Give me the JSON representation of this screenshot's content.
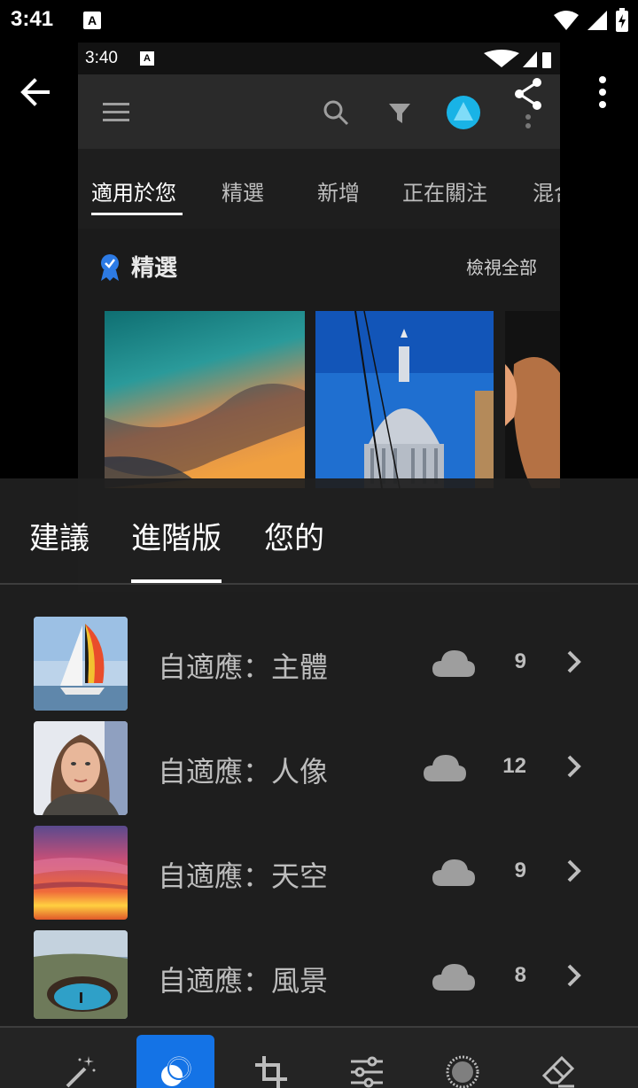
{
  "status_bar": {
    "time": "3:41",
    "notification_icon": "A"
  },
  "embedded": {
    "status_time": "3:40",
    "notification_icon": "A",
    "tabs": [
      "適用於您",
      "精選",
      "新增",
      "正在關注",
      "混合"
    ],
    "featured": {
      "title": "精選",
      "view_all": "檢視全部"
    }
  },
  "sheet": {
    "tabs": [
      "建議",
      "進階版",
      "您的"
    ],
    "active_tab": "進階版",
    "presets": [
      {
        "label": "自適應：主體",
        "count": "9",
        "thumb": "sailboat"
      },
      {
        "label": "自適應：人像",
        "count": "12",
        "thumb": "portrait"
      },
      {
        "label": "自適應：天空",
        "count": "9",
        "thumb": "sunset-sky"
      },
      {
        "label": "自適應：風景",
        "count": "8",
        "thumb": "crater-lake"
      }
    ]
  },
  "toolbar": {
    "items": [
      "auto-magic-wand-icon",
      "masking-icon",
      "crop-icon",
      "adjust-sliders-icon",
      "vignette-icon",
      "eraser-icon"
    ],
    "active_index": 1
  },
  "colors": {
    "accent": "#1473e6",
    "sheet_bg": "#202020",
    "text_muted": "#bdbdbd"
  }
}
